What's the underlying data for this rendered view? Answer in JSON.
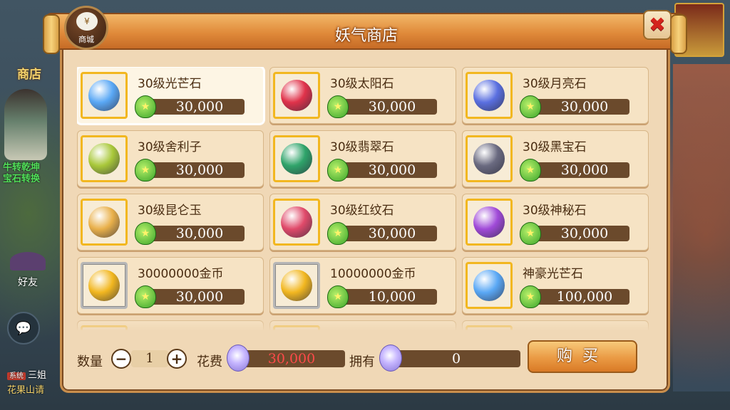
{
  "background": {
    "shop_sign": "商店",
    "npc_label_1": "牛转乾坤",
    "npc_label_2": "宝石转换",
    "friends_label": "好友",
    "chat_tag": "系统",
    "chat_line_1": "三姐",
    "chat_line_2": "花果山请"
  },
  "dialog": {
    "title": "妖气商店",
    "badge_label": "商城",
    "badge_glyph": "¥",
    "close_icon": "✖"
  },
  "items": [
    {
      "name": "30级光芒石",
      "price": "30,000",
      "icon": "blue-crystal-icon",
      "color": "#5aa8f5",
      "frame": "gold",
      "selected": true
    },
    {
      "name": "30级太阳石",
      "price": "30,000",
      "icon": "red-swirl-gem-icon",
      "color": "#e0324a",
      "frame": "gold"
    },
    {
      "name": "30级月亮石",
      "price": "30,000",
      "icon": "crescent-moon-gem-icon",
      "color": "#5a6fe0",
      "frame": "gold"
    },
    {
      "name": "30级舍利子",
      "price": "30,000",
      "icon": "green-beads-icon",
      "color": "#a9c83a",
      "frame": "gold"
    },
    {
      "name": "30级翡翠石",
      "price": "30,000",
      "icon": "jade-orb-icon",
      "color": "#2fa46a",
      "frame": "gold"
    },
    {
      "name": "30级黑宝石",
      "price": "30,000",
      "icon": "black-diamond-icon",
      "color": "#6a6a80",
      "frame": "gold"
    },
    {
      "name": "30级昆仑玉",
      "price": "30,000",
      "icon": "amber-jade-icon",
      "color": "#e9b04a",
      "frame": "gold"
    },
    {
      "name": "30级红纹石",
      "price": "30,000",
      "icon": "red-stripe-gem-icon",
      "color": "#e04a6a",
      "frame": "gold"
    },
    {
      "name": "30级神秘石",
      "price": "30,000",
      "icon": "purple-crystal-icon",
      "color": "#a04ad8",
      "frame": "gold"
    },
    {
      "name": "30000000金币",
      "price": "30,000",
      "icon": "gold-coin-icon",
      "color": "#f2b720",
      "frame": "silver"
    },
    {
      "name": "10000000金币",
      "price": "10,000",
      "icon": "gold-coin-icon",
      "color": "#f2b720",
      "frame": "silver"
    },
    {
      "name": "神豪光芒石",
      "price": "100,000",
      "icon": "blue-crystal-icon",
      "color": "#5aa8f5",
      "frame": "gold"
    }
  ],
  "price_currency_icon": "green-gourd-icon",
  "purchase": {
    "quantity_label": "数量",
    "quantity": "1",
    "minus": "−",
    "plus": "+",
    "cost_label": "花费",
    "cost": "30,000",
    "cost_color": "#ff4a4a",
    "owned_label": "拥有",
    "owned": "0",
    "buy_label": "购买",
    "currency_icon": "spirit-gourd-icon"
  }
}
